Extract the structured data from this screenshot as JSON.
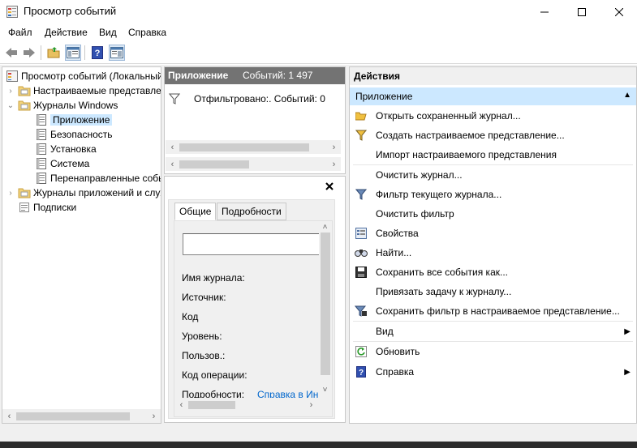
{
  "window": {
    "title": "Просмотр событий"
  },
  "menu": {
    "items": [
      "Файл",
      "Действие",
      "Вид",
      "Справка"
    ]
  },
  "toolbar": {
    "buttons": [
      "back-icon",
      "forward-icon",
      "open-folder-icon",
      "view-icon",
      "help-icon",
      "show-hide-pane-icon"
    ]
  },
  "tree": {
    "items": [
      {
        "label": "Просмотр событий (Локальный)"
      },
      {
        "label": "Настраиваемые представления"
      },
      {
        "label": "Журналы Windows"
      },
      {
        "label": "Приложение"
      },
      {
        "label": "Безопасность"
      },
      {
        "label": "Установка"
      },
      {
        "label": "Система"
      },
      {
        "label": "Перенаправленные события"
      },
      {
        "label": "Журналы приложений и служб"
      },
      {
        "label": "Подписки"
      }
    ]
  },
  "middle": {
    "log_name": "Приложение",
    "event_count": "Событий: 1 497",
    "filter_text": "Отфильтровано:. Событий: 0",
    "tabs": [
      "Общие",
      "Подробности"
    ],
    "fields": {
      "log": "Имя журнала:",
      "source": "Источник:",
      "code": "Код",
      "level": "Уровень:",
      "user": "Пользов.:",
      "opcode": "Код операции:",
      "details": "Подробности:",
      "details_link": "Справка в Интернете"
    }
  },
  "actions": {
    "header": "Действия",
    "section": "Приложение",
    "items": [
      {
        "label": "Открыть сохраненный журнал...",
        "icon": "open-folder-icon"
      },
      {
        "label": "Создать настраиваемое представление...",
        "icon": "create-filter-icon"
      },
      {
        "label": "Импорт настраиваемого представления",
        "icon": ""
      },
      {
        "label": "Очистить журнал...",
        "icon": ""
      },
      {
        "label": "Фильтр текущего журнала...",
        "icon": "filter-icon"
      },
      {
        "label": "Очистить фильтр",
        "icon": ""
      },
      {
        "label": "Свойства",
        "icon": "properties-icon"
      },
      {
        "label": "Найти...",
        "icon": "find-icon"
      },
      {
        "label": "Сохранить все события как...",
        "icon": "save-icon"
      },
      {
        "label": "Привязать задачу к журналу...",
        "icon": ""
      },
      {
        "label": "Сохранить фильтр в настраиваемое представление...",
        "icon": "save-filter-icon"
      },
      {
        "label": "Вид",
        "icon": ""
      },
      {
        "label": "Обновить",
        "icon": "refresh-icon"
      },
      {
        "label": "Справка",
        "icon": "help-icon"
      }
    ]
  }
}
